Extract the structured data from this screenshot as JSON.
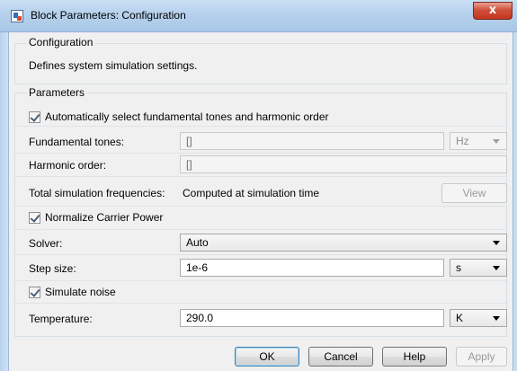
{
  "window": {
    "title": "Block Parameters: Configuration",
    "close_glyph": "x"
  },
  "configuration": {
    "group_title": "Configuration",
    "description": "Defines system simulation settings."
  },
  "parameters": {
    "group_title": "Parameters",
    "auto_select": {
      "label": "Automatically select fundamental tones and harmonic order",
      "checked": true
    },
    "fundamental_tones": {
      "label": "Fundamental tones:",
      "value": "[]",
      "unit": "Hz"
    },
    "harmonic_order": {
      "label": "Harmonic order:",
      "value": "[]"
    },
    "total_sim_freq": {
      "label": "Total simulation frequencies:",
      "value": "Computed at simulation time",
      "view_label": "View"
    },
    "normalize_carrier": {
      "label": "Normalize Carrier Power",
      "checked": true
    },
    "solver": {
      "label": "Solver:",
      "value": "Auto"
    },
    "step_size": {
      "label": "Step size:",
      "value": "1e-6",
      "unit": "s"
    },
    "simulate_noise": {
      "label": "Simulate noise",
      "checked": true
    },
    "temperature": {
      "label": "Temperature:",
      "value": "290.0",
      "unit": "K"
    }
  },
  "buttons": {
    "ok": "OK",
    "cancel": "Cancel",
    "help": "Help",
    "apply": "Apply"
  },
  "colors": {
    "titlebar": "#b6d1ec",
    "close_button": "#c2361f",
    "dialog_bg": "#f0f0f0",
    "default_button_border": "#3c7fb1"
  }
}
